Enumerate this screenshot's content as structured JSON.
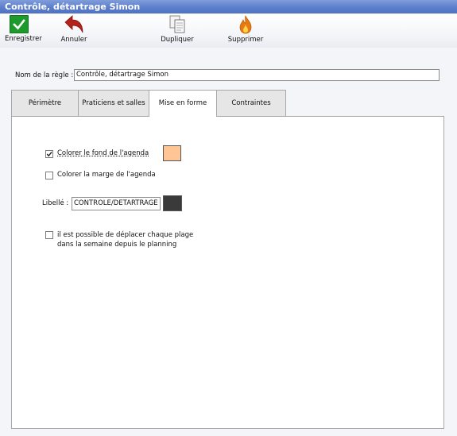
{
  "window": {
    "title": "Contrôle, détartrage Simon"
  },
  "toolbar": {
    "save_label": "Enregistrer",
    "cancel_label": "Annuler",
    "duplicate_label": "Dupliquer",
    "delete_label": "Supprimer",
    "icons": {
      "save": "checkmark-icon",
      "cancel": "undo-arrow-icon",
      "duplicate": "copy-documents-icon",
      "delete": "flame-icon"
    }
  },
  "rule": {
    "name_label": "Nom de la règle :",
    "name_value": "Contrôle, détartrage Simon"
  },
  "tabs": [
    {
      "label": "Périmètre"
    },
    {
      "label": "Praticiens et salles"
    },
    {
      "label": "Mise en forme"
    },
    {
      "label": "Contraintes"
    }
  ],
  "active_tab": "Mise en forme",
  "formatting": {
    "color_background_label": "Colorer le fond de l'agenda",
    "color_background_checked": true,
    "background_color": "#ffc595",
    "color_margin_label": "Colorer la marge de l'agenda",
    "color_margin_checked": false,
    "libelle_label": "Libellé :",
    "libelle_value": "CONTROLE/DETARTRAGE",
    "libelle_color": "#3a3a3a",
    "move_label_line1": "il est possible de déplacer chaque plage",
    "move_label_line2": "dans la semaine depuis le planning",
    "move_checked": false
  }
}
